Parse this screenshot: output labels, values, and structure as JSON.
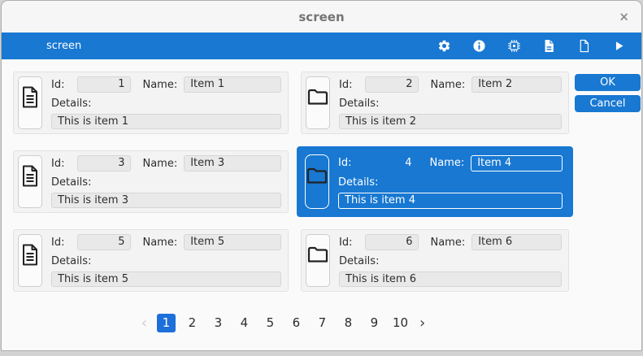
{
  "window": {
    "title": "screen",
    "close_glyph": "×"
  },
  "toolbar": {
    "title": "screen",
    "icons": [
      "settings",
      "info",
      "chip",
      "document-text",
      "document-blank",
      "run"
    ]
  },
  "labels": {
    "id": "Id:",
    "name": "Name:",
    "details": "Details:"
  },
  "items": [
    {
      "id": "1",
      "name": "Item 1",
      "details": "This is item 1",
      "icon": "document",
      "selected": false
    },
    {
      "id": "2",
      "name": "Item 2",
      "details": "This is item 2",
      "icon": "folder",
      "selected": false
    },
    {
      "id": "3",
      "name": "Item 3",
      "details": "This is item 3",
      "icon": "document",
      "selected": false
    },
    {
      "id": "4",
      "name": "Item 4",
      "details": "This is item 4",
      "icon": "folder",
      "selected": true
    },
    {
      "id": "5",
      "name": "Item 5",
      "details": "This is item 5",
      "icon": "document",
      "selected": false
    },
    {
      "id": "6",
      "name": "Item 6",
      "details": "This is item 6",
      "icon": "folder",
      "selected": false
    }
  ],
  "actions": {
    "ok": "OK",
    "cancel": "Cancel"
  },
  "pagination": {
    "prev": "‹",
    "next": "›",
    "pages": [
      "1",
      "2",
      "3",
      "4",
      "5",
      "6",
      "7",
      "8",
      "9",
      "10"
    ],
    "active_page": "1"
  },
  "colors": {
    "accent": "#1878d2",
    "selected_card": "#1878d2",
    "pagination_active": "#1d6fd9"
  }
}
